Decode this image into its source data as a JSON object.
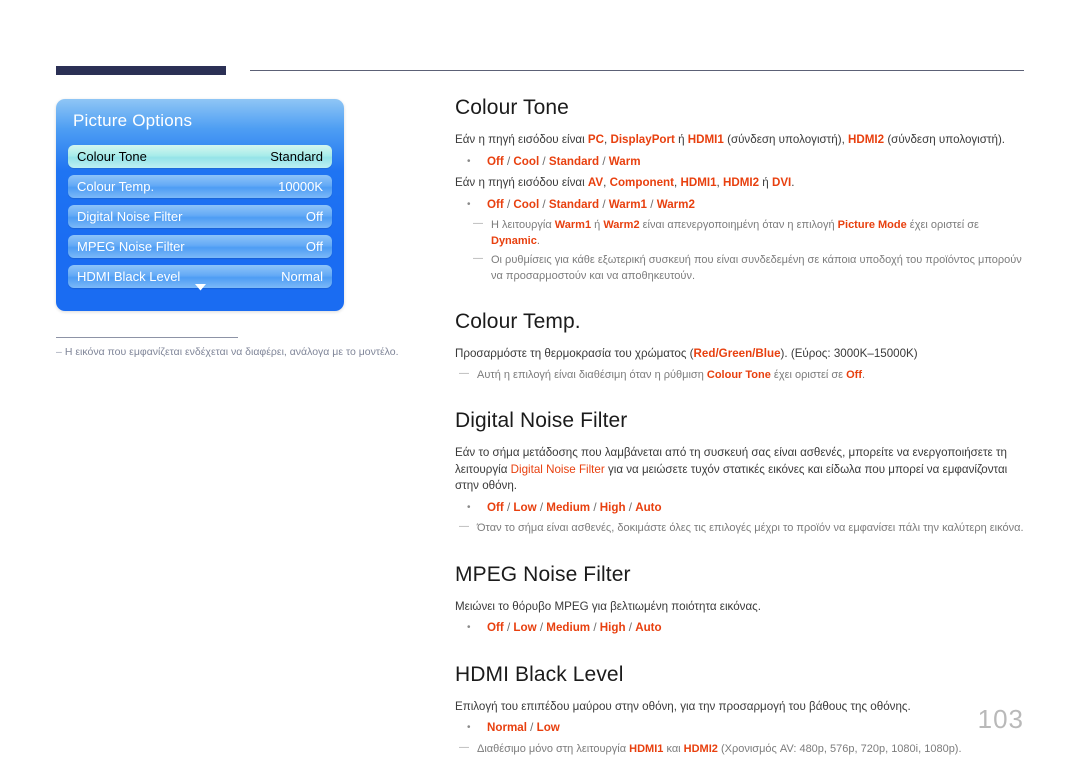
{
  "page": {
    "number": "103"
  },
  "osd": {
    "title": "Picture Options",
    "rows": [
      {
        "label": "Colour Tone",
        "value": "Standard",
        "selected": true
      },
      {
        "label": "Colour Temp.",
        "value": "10000K",
        "selected": false
      },
      {
        "label": "Digital Noise Filter",
        "value": "Off",
        "selected": false
      },
      {
        "label": "MPEG Noise Filter",
        "value": "Off",
        "selected": false
      },
      {
        "label": "HDMI Black Level",
        "value": "Normal",
        "selected": false
      }
    ],
    "scroll_arrow": "chevron-down-icon"
  },
  "left_note": {
    "dash": "–",
    "text": "Η εικόνα που εμφανίζεται ενδέχεται να διαφέρει, ανάλογα με το μοντέλο."
  },
  "sections": [
    {
      "id": "colour-tone",
      "title": "Colour Tone",
      "p1_a": "Εάν η πηγή εισόδου είναι ",
      "p1_pc": "PC",
      "p1_b": ", ",
      "p1_dp": "DisplayPort",
      "p1_c": " ή ",
      "p1_hdmi1": "HDMI1",
      "p1_d": " (σύνδεση υπολογιστή), ",
      "p1_hdmi2": "HDMI2",
      "p1_e": " (σύνδεση υπολογιστή).",
      "options1": [
        "Off",
        "Cool",
        "Standard",
        "Warm"
      ],
      "p2_a": "Εάν η πηγή εισόδου είναι ",
      "p2_av": "AV",
      "p2_b": ", ",
      "p2_comp": "Component",
      "p2_c": ", ",
      "p2_hdmi1": "HDMI1",
      "p2_d": ", ",
      "p2_hdmi2": "HDMI2",
      "p2_e": "  ή ",
      "p2_dvi": "DVI",
      "p2_f": ".",
      "options2": [
        "Off",
        "Cool",
        "Standard",
        "Warm1",
        "Warm2"
      ],
      "note1_a": "Η λειτουργία ",
      "note1_warm1": "Warm1",
      "note1_b": " ή ",
      "note1_warm2": "Warm2",
      "note1_c": " είναι απενεργοποιημένη όταν η επιλογή ",
      "note1_pm": "Picture Mode",
      "note1_d": " έχει οριστεί σε ",
      "note1_dyn": "Dynamic",
      "note1_e": ".",
      "note2": "Οι ρυθμίσεις για κάθε εξωτερική συσκευή που είναι συνδεδεμένη σε κάποια υποδοχή του προϊόντος μπορούν να προσαρμοστούν και να αποθηκευτούν."
    },
    {
      "id": "colour-temp",
      "title": "Colour Temp.",
      "p1_a": "Προσαρμόστε τη θερμοκρασία του χρώματος (",
      "p1_rgb": "Red/Green/Blue",
      "p1_b": "). (Εύρος: 3000K–15000K)",
      "note1_a": "Αυτή η επιλογή είναι διαθέσιμη όταν η ρύθμιση ",
      "note1_ct": "Colour Tone",
      "note1_b": " έχει οριστεί σε ",
      "note1_off": "Off",
      "note1_c": "."
    },
    {
      "id": "digital-noise-filter",
      "title": "Digital Noise Filter",
      "p1_a": "Εάν το σήμα μετάδοσης που λαμβάνεται από τη συσκευή σας είναι ασθενές, μπορείτε να ενεργοποιήσετε τη λειτουργία ",
      "p1_dnf": "Digital Noise Filter",
      "p1_b": " για να μειώσετε τυχόν στατικές εικόνες και είδωλα που μπορεί να εμφανίζονται στην οθόνη.",
      "options": [
        "Off",
        "Low",
        "Medium",
        "High",
        "Auto"
      ],
      "note1": "Όταν το σήμα είναι ασθενές, δοκιμάστε όλες τις επιλογές μέχρι το προϊόν να εμφανίσει πάλι την καλύτερη εικόνα."
    },
    {
      "id": "mpeg-noise-filter",
      "title": "MPEG Noise Filter",
      "p1": "Μειώνει το θόρυβο MPEG για βελτιωμένη ποιότητα εικόνας.",
      "options": [
        "Off",
        "Low",
        "Medium",
        "High",
        "Auto"
      ]
    },
    {
      "id": "hdmi-black-level",
      "title": "HDMI Black Level",
      "p1": "Επιλογή του επιπέδου μαύρου στην οθόνη, για την προσαρμογή του βάθους της οθόνης.",
      "options": [
        "Normal",
        "Low"
      ],
      "note1_a": "Διαθέσιμο μόνο στη λειτουργία ",
      "note1_h1": "HDMI1",
      "note1_b": " και ",
      "note1_h2": "HDMI2",
      "note1_c": " (Χρονισμός AV: 480p, 576p, 720p, 1080i, 1080p)."
    }
  ],
  "colors": {
    "highlight": "#e8400f",
    "header_block": "#2b3055",
    "osd_blue": "#1a6cf2",
    "osd_selected": "#a9ecea",
    "page_number": "#b9b9b9"
  }
}
